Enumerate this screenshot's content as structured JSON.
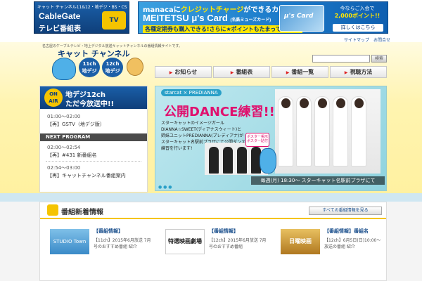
{
  "banners": {
    "cablegate": {
      "top": "キャット チャンネル11&12・地デジ・BS・CS",
      "main": "CableGate",
      "sub": "テレビ番組表",
      "tv": "TV"
    },
    "manaca": {
      "line1_prefix": "manacaに",
      "line1_highlight": "クレジットチャージ",
      "line1_suffix": "ができるカード!",
      "line2": "MEITETSU μ's Card",
      "line2_note": "(名鉄ミューズカード)",
      "line3": "各種定期券も購入できる!さらに★ポイントもたまってオトク!",
      "card_label": "μ's Card",
      "promo": "今ならご入会で",
      "promo_num": "2,000ポイント!!",
      "button": "詳しくはこちら"
    }
  },
  "util_links": [
    "サイトマップ",
    "お問合せ"
  ],
  "site_desc": "名古屋のケーブルテレビ・地上デジタル放送キャットチャンネルの番組情報サイトです。",
  "logo": {
    "title": "キャット チャンネル",
    "badge11": "11ch",
    "badge11_sub": "地デジ",
    "badge12": "12ch",
    "badge12_sub": "地デジ"
  },
  "search": {
    "placeholder": "",
    "button": "検索"
  },
  "nav": [
    "お知らせ",
    "番組表",
    "番組一覧",
    "視聴方法"
  ],
  "onair": {
    "badge": "ON AIR",
    "title1": "地デジ12ch",
    "title2": "ただ今放送中!!",
    "time": "01:00～02:00",
    "program": "【再】GSTV（地デジ版）",
    "next_label": "NEXT PROGRAM",
    "next": [
      {
        "time": "02:00～02:54",
        "program": "【再】#431 新番組名"
      },
      {
        "time": "02:54～03:00",
        "program": "【再】キャットチャンネル番組案内"
      }
    ]
  },
  "hero": {
    "logos": "starcat × PREDIANNA",
    "title": "公開DANCE練習!!",
    "body": "スターキャットのイメージガールDIANNA☆SWEET(ディアナスウィート)と姉妹ユニットPREDIANNA(プレディアナ)がスターキャット名駅前プラザにて公開ダンス練習を行います!",
    "pink_note": "ポスター掲示 ポスター貼付",
    "caption": "毎週(月) 18:30～ スターキャット名駅前プラザにて",
    "dots": "● ● ●"
  },
  "news": {
    "title": "番組新着情報",
    "more": "すべての番組情報を見る",
    "cards": [
      {
        "title": "【番組情報】",
        "thumb_text": "STUDIO Town",
        "desc": "【11ch】2015年6月放送 7月号のおすすめ番組 紹介"
      },
      {
        "title": "【番組情報】",
        "thumb_text": "特選映画劇場",
        "desc": "【12ch】2015年6月放送 7月号のおすすめ番組"
      },
      {
        "title": "【番組情報】番組名",
        "thumb_text": "日曜映画",
        "desc": "【12ch】6月5日(日)10:00～ 放送の番組 紹介"
      }
    ]
  },
  "colors": {
    "brand_blue": "#0f3f7a",
    "accent_yellow": "#f5c400",
    "hero_pink": "#e0116e"
  }
}
